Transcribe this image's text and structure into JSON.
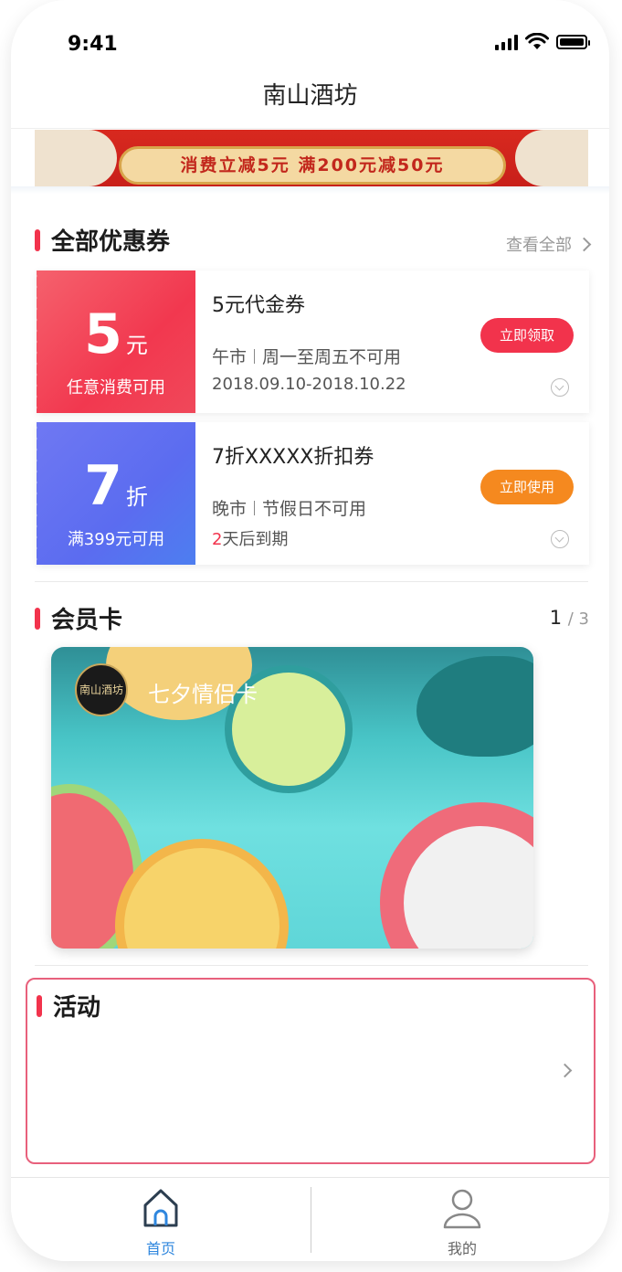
{
  "status_bar": {
    "time": "9:41"
  },
  "nav": {
    "title": "南山酒坊"
  },
  "banner": {
    "text": "消费立减5元  满200元减50元"
  },
  "coupons_section": {
    "title": "全部优惠券",
    "view_all": "查看全部",
    "coupons": [
      {
        "amount": "5",
        "unit": "元",
        "condition": "任意消费可用",
        "name": "5元代金券",
        "period": "午市",
        "restriction": "周一至周五不可用",
        "date": "2018.09.10-2018.10.22",
        "button": "立即领取",
        "color": "#f2334c"
      },
      {
        "amount": "7",
        "unit": "折",
        "condition": "满399元可用",
        "name": "7折XXXXX折扣券",
        "period": "晚市",
        "restriction": "节假日不可用",
        "expire_days": "2",
        "expire_text": "天后到期",
        "button": "立即使用",
        "color": "#f5891f"
      }
    ]
  },
  "member_section": {
    "title": "会员卡",
    "page_current": "1",
    "page_total": "/ 3",
    "card": {
      "logo_text": "南山酒坊",
      "name": "七夕情侣卡"
    }
  },
  "activity_section": {
    "title": "活动"
  },
  "tabbar": {
    "home": "首页",
    "mine": "我的"
  },
  "colors": {
    "accent_red": "#f2334c",
    "accent_orange": "#f5891f",
    "tab_active": "#2e86de"
  }
}
